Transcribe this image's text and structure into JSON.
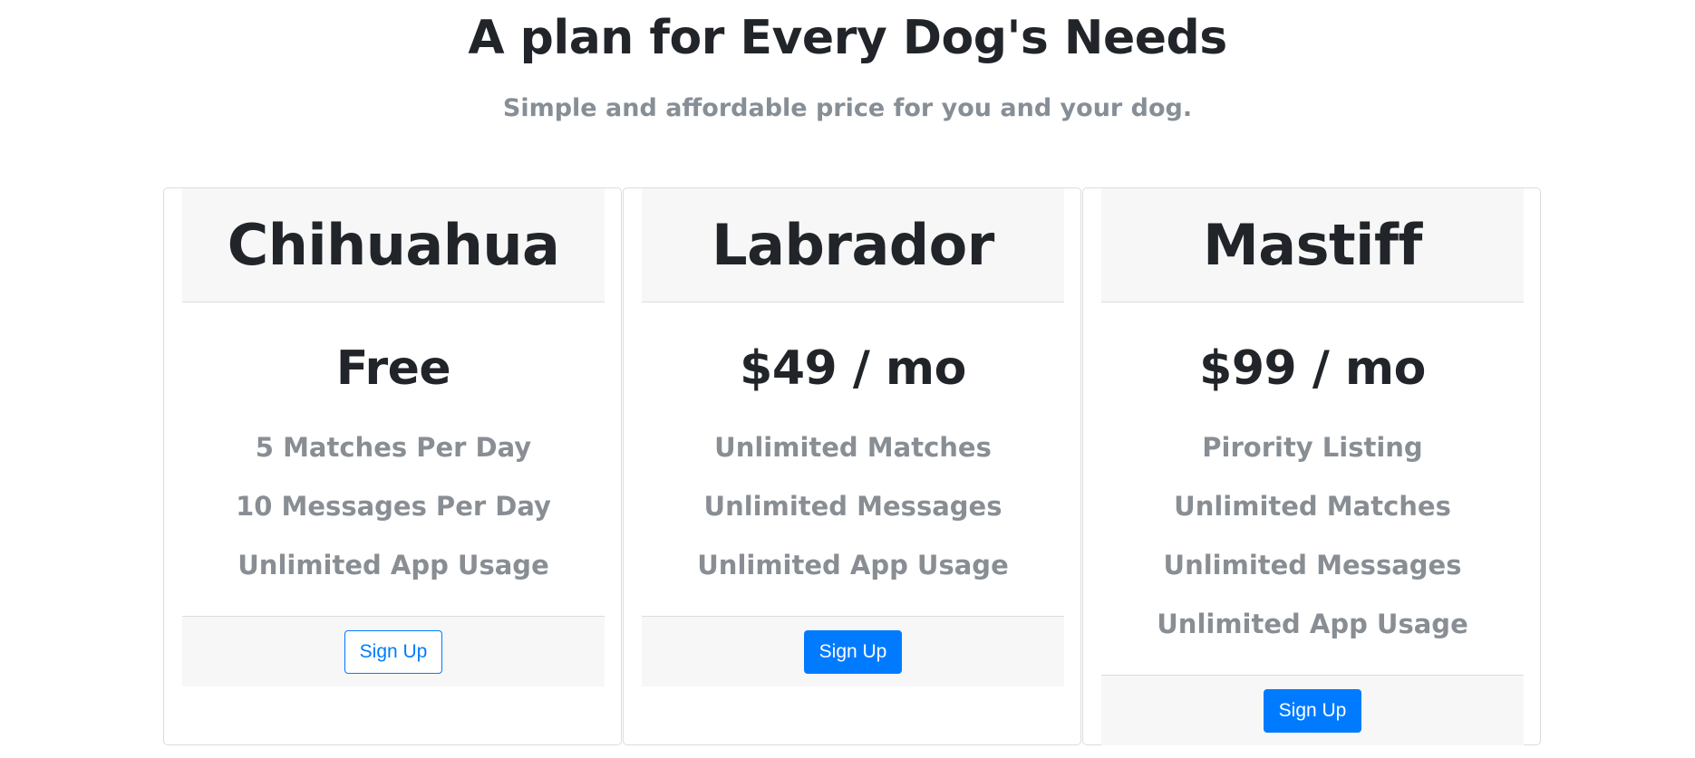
{
  "header": {
    "title": "A plan for Every Dog's Needs",
    "subtitle": "Simple and affordable price for you and your dog."
  },
  "plans": [
    {
      "name": "Chihuahua",
      "price": "Free",
      "features": [
        "5 Matches Per Day",
        "10 Messages Per Day",
        "Unlimited App Usage"
      ],
      "button_label": "Sign Up",
      "button_style": "outline"
    },
    {
      "name": "Labrador",
      "price": "$49 / mo",
      "features": [
        "Unlimited Matches",
        "Unlimited Messages",
        "Unlimited App Usage"
      ],
      "button_label": "Sign Up",
      "button_style": "solid"
    },
    {
      "name": "Mastiff",
      "price": "$99 / mo",
      "features": [
        "Pirority Listing",
        "Unlimited Matches",
        "Unlimited Messages",
        "Unlimited App Usage"
      ],
      "button_label": "Sign Up",
      "button_style": "solid"
    }
  ],
  "colors": {
    "primary": "#007bff",
    "heading": "#212529",
    "muted": "#868e96",
    "panel": "#f7f7f7",
    "border": "#dcdcdc"
  }
}
